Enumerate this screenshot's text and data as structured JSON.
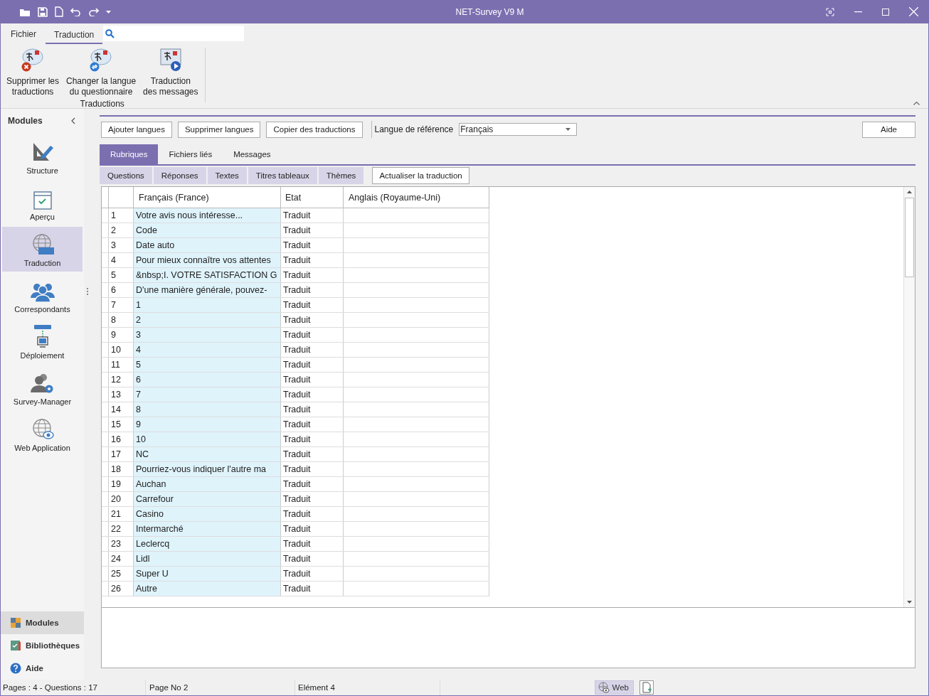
{
  "window": {
    "title": "NET-Survey V9 M"
  },
  "ribbon": {
    "tabs": [
      {
        "label": "Fichier",
        "selected": false
      },
      {
        "label": "Traduction",
        "selected": true
      }
    ],
    "commands": [
      {
        "kind": "delete",
        "lines": [
          "Supprimer les",
          "traductions"
        ]
      },
      {
        "kind": "change",
        "lines": [
          "Changer la langue",
          "du questionnaire"
        ]
      },
      {
        "kind": "messages",
        "lines": [
          "Traduction",
          "des messages"
        ]
      }
    ],
    "group_label": "Traductions"
  },
  "sidebar": {
    "title": "Modules",
    "items": [
      {
        "kind": "structure",
        "label": "Structure",
        "selected": false
      },
      {
        "kind": "preview",
        "label": "Aperçu",
        "selected": false
      },
      {
        "kind": "translation",
        "label": "Traduction",
        "selected": true
      },
      {
        "kind": "contacts",
        "label": "Correspondants",
        "selected": false
      },
      {
        "kind": "deploy",
        "label": "Déploiement",
        "selected": false
      },
      {
        "kind": "manager",
        "label": "Survey-Manager",
        "selected": false
      },
      {
        "kind": "web",
        "label": "Web Application",
        "selected": false
      }
    ],
    "bottom": [
      {
        "kind": "modules",
        "label": "Modules",
        "selected": true
      },
      {
        "kind": "library",
        "label": "Bibliothèques",
        "selected": false
      },
      {
        "kind": "help",
        "label": "Aide",
        "selected": false
      }
    ]
  },
  "toolbar": {
    "buttons": [
      "Ajouter langues",
      "Supprimer langues",
      "Copier des traductions"
    ],
    "reference_label": "Langue de référence",
    "reference_value": "Français",
    "help": "Aide"
  },
  "tabs": [
    {
      "label": "Rubriques",
      "selected": true
    },
    {
      "label": "Fichiers liés",
      "selected": false
    },
    {
      "label": "Messages",
      "selected": false
    }
  ],
  "subtabs": [
    {
      "label": "Questions",
      "selected": false
    },
    {
      "label": "Réponses",
      "selected": false
    },
    {
      "label": "Textes",
      "selected": false
    },
    {
      "label": "Titres tableaux",
      "selected": false
    },
    {
      "label": "Thèmes",
      "selected": false
    }
  ],
  "refresh_button": "Actualiser la traduction",
  "table": {
    "columns": [
      "Français (France)",
      "Etat",
      "Anglais (Royaume-Uni)"
    ],
    "rows": [
      {
        "number": "1",
        "source": "Votre avis nous intéresse...",
        "state": "Traduit"
      },
      {
        "number": "2",
        "source": "Code",
        "state": "Traduit"
      },
      {
        "number": "3",
        "source": "Date auto",
        "state": "Traduit"
      },
      {
        "number": "4",
        "source": "Pour mieux connaître vos attentes",
        "state": "Traduit"
      },
      {
        "number": "5",
        "source": "&nbsp;I. VOTRE SATISFACTION G",
        "state": "Traduit"
      },
      {
        "number": "6",
        "source": "D'une manière générale, pouvez-",
        "state": "Traduit"
      },
      {
        "number": "7",
        "source": "1",
        "state": "Traduit"
      },
      {
        "number": "8",
        "source": "2",
        "state": "Traduit"
      },
      {
        "number": "9",
        "source": "3",
        "state": "Traduit"
      },
      {
        "number": "10",
        "source": "4",
        "state": "Traduit"
      },
      {
        "number": "11",
        "source": "5",
        "state": "Traduit"
      },
      {
        "number": "12",
        "source": "6",
        "state": "Traduit"
      },
      {
        "number": "13",
        "source": "7",
        "state": "Traduit"
      },
      {
        "number": "14",
        "source": "8",
        "state": "Traduit"
      },
      {
        "number": "15",
        "source": "9",
        "state": "Traduit"
      },
      {
        "number": "16",
        "source": "10",
        "state": "Traduit"
      },
      {
        "number": "17",
        "source": "NC",
        "state": "Traduit"
      },
      {
        "number": "18",
        "source": "Pourriez-vous indiquer l'autre ma",
        "state": "Traduit"
      },
      {
        "number": "19",
        "source": "Auchan",
        "state": "Traduit"
      },
      {
        "number": "20",
        "source": "Carrefour",
        "state": "Traduit"
      },
      {
        "number": "21",
        "source": "Casino",
        "state": "Traduit"
      },
      {
        "number": "22",
        "source": "Intermarché",
        "state": "Traduit"
      },
      {
        "number": "23",
        "source": "Leclercq",
        "state": "Traduit"
      },
      {
        "number": "24",
        "source": "Lidl",
        "state": "Traduit"
      },
      {
        "number": "25",
        "source": "Super U",
        "state": "Traduit"
      },
      {
        "number": "26",
        "source": "Autre",
        "state": "Traduit"
      }
    ]
  },
  "status_bar": {
    "pages": "Pages : 4 - Questions : 17",
    "page": "Page No 2",
    "element": "Elément 4",
    "web": "Web"
  }
}
